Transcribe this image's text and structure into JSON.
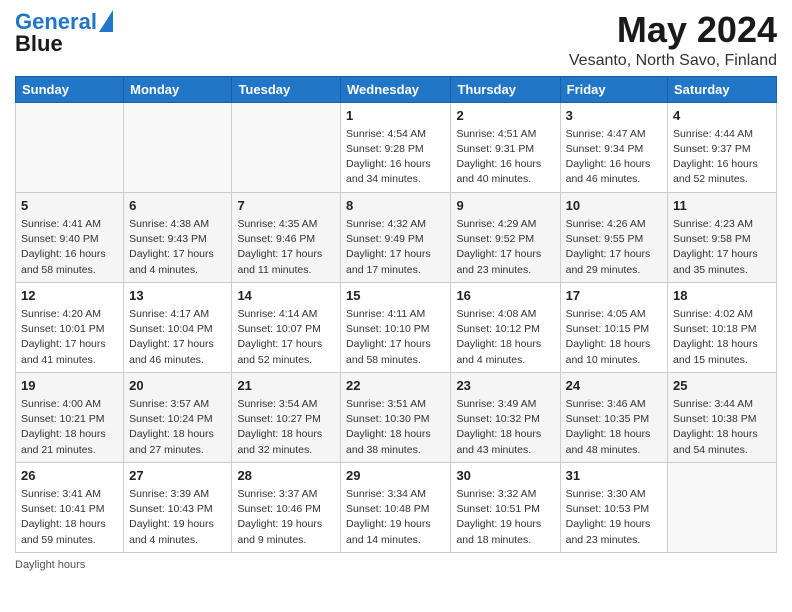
{
  "logo": {
    "line1": "General",
    "line2": "Blue"
  },
  "title": "May 2024",
  "subtitle": "Vesanto, North Savo, Finland",
  "days_of_week": [
    "Sunday",
    "Monday",
    "Tuesday",
    "Wednesday",
    "Thursday",
    "Friday",
    "Saturday"
  ],
  "weeks": [
    [
      {
        "day": "",
        "info": ""
      },
      {
        "day": "",
        "info": ""
      },
      {
        "day": "",
        "info": ""
      },
      {
        "day": "1",
        "info": "Sunrise: 4:54 AM\nSunset: 9:28 PM\nDaylight: 16 hours and 34 minutes."
      },
      {
        "day": "2",
        "info": "Sunrise: 4:51 AM\nSunset: 9:31 PM\nDaylight: 16 hours and 40 minutes."
      },
      {
        "day": "3",
        "info": "Sunrise: 4:47 AM\nSunset: 9:34 PM\nDaylight: 16 hours and 46 minutes."
      },
      {
        "day": "4",
        "info": "Sunrise: 4:44 AM\nSunset: 9:37 PM\nDaylight: 16 hours and 52 minutes."
      }
    ],
    [
      {
        "day": "5",
        "info": "Sunrise: 4:41 AM\nSunset: 9:40 PM\nDaylight: 16 hours and 58 minutes."
      },
      {
        "day": "6",
        "info": "Sunrise: 4:38 AM\nSunset: 9:43 PM\nDaylight: 17 hours and 4 minutes."
      },
      {
        "day": "7",
        "info": "Sunrise: 4:35 AM\nSunset: 9:46 PM\nDaylight: 17 hours and 11 minutes."
      },
      {
        "day": "8",
        "info": "Sunrise: 4:32 AM\nSunset: 9:49 PM\nDaylight: 17 hours and 17 minutes."
      },
      {
        "day": "9",
        "info": "Sunrise: 4:29 AM\nSunset: 9:52 PM\nDaylight: 17 hours and 23 minutes."
      },
      {
        "day": "10",
        "info": "Sunrise: 4:26 AM\nSunset: 9:55 PM\nDaylight: 17 hours and 29 minutes."
      },
      {
        "day": "11",
        "info": "Sunrise: 4:23 AM\nSunset: 9:58 PM\nDaylight: 17 hours and 35 minutes."
      }
    ],
    [
      {
        "day": "12",
        "info": "Sunrise: 4:20 AM\nSunset: 10:01 PM\nDaylight: 17 hours and 41 minutes."
      },
      {
        "day": "13",
        "info": "Sunrise: 4:17 AM\nSunset: 10:04 PM\nDaylight: 17 hours and 46 minutes."
      },
      {
        "day": "14",
        "info": "Sunrise: 4:14 AM\nSunset: 10:07 PM\nDaylight: 17 hours and 52 minutes."
      },
      {
        "day": "15",
        "info": "Sunrise: 4:11 AM\nSunset: 10:10 PM\nDaylight: 17 hours and 58 minutes."
      },
      {
        "day": "16",
        "info": "Sunrise: 4:08 AM\nSunset: 10:12 PM\nDaylight: 18 hours and 4 minutes."
      },
      {
        "day": "17",
        "info": "Sunrise: 4:05 AM\nSunset: 10:15 PM\nDaylight: 18 hours and 10 minutes."
      },
      {
        "day": "18",
        "info": "Sunrise: 4:02 AM\nSunset: 10:18 PM\nDaylight: 18 hours and 15 minutes."
      }
    ],
    [
      {
        "day": "19",
        "info": "Sunrise: 4:00 AM\nSunset: 10:21 PM\nDaylight: 18 hours and 21 minutes."
      },
      {
        "day": "20",
        "info": "Sunrise: 3:57 AM\nSunset: 10:24 PM\nDaylight: 18 hours and 27 minutes."
      },
      {
        "day": "21",
        "info": "Sunrise: 3:54 AM\nSunset: 10:27 PM\nDaylight: 18 hours and 32 minutes."
      },
      {
        "day": "22",
        "info": "Sunrise: 3:51 AM\nSunset: 10:30 PM\nDaylight: 18 hours and 38 minutes."
      },
      {
        "day": "23",
        "info": "Sunrise: 3:49 AM\nSunset: 10:32 PM\nDaylight: 18 hours and 43 minutes."
      },
      {
        "day": "24",
        "info": "Sunrise: 3:46 AM\nSunset: 10:35 PM\nDaylight: 18 hours and 48 minutes."
      },
      {
        "day": "25",
        "info": "Sunrise: 3:44 AM\nSunset: 10:38 PM\nDaylight: 18 hours and 54 minutes."
      }
    ],
    [
      {
        "day": "26",
        "info": "Sunrise: 3:41 AM\nSunset: 10:41 PM\nDaylight: 18 hours and 59 minutes."
      },
      {
        "day": "27",
        "info": "Sunrise: 3:39 AM\nSunset: 10:43 PM\nDaylight: 19 hours and 4 minutes."
      },
      {
        "day": "28",
        "info": "Sunrise: 3:37 AM\nSunset: 10:46 PM\nDaylight: 19 hours and 9 minutes."
      },
      {
        "day": "29",
        "info": "Sunrise: 3:34 AM\nSunset: 10:48 PM\nDaylight: 19 hours and 14 minutes."
      },
      {
        "day": "30",
        "info": "Sunrise: 3:32 AM\nSunset: 10:51 PM\nDaylight: 19 hours and 18 minutes."
      },
      {
        "day": "31",
        "info": "Sunrise: 3:30 AM\nSunset: 10:53 PM\nDaylight: 19 hours and 23 minutes."
      },
      {
        "day": "",
        "info": ""
      }
    ]
  ],
  "footer": "Daylight hours"
}
